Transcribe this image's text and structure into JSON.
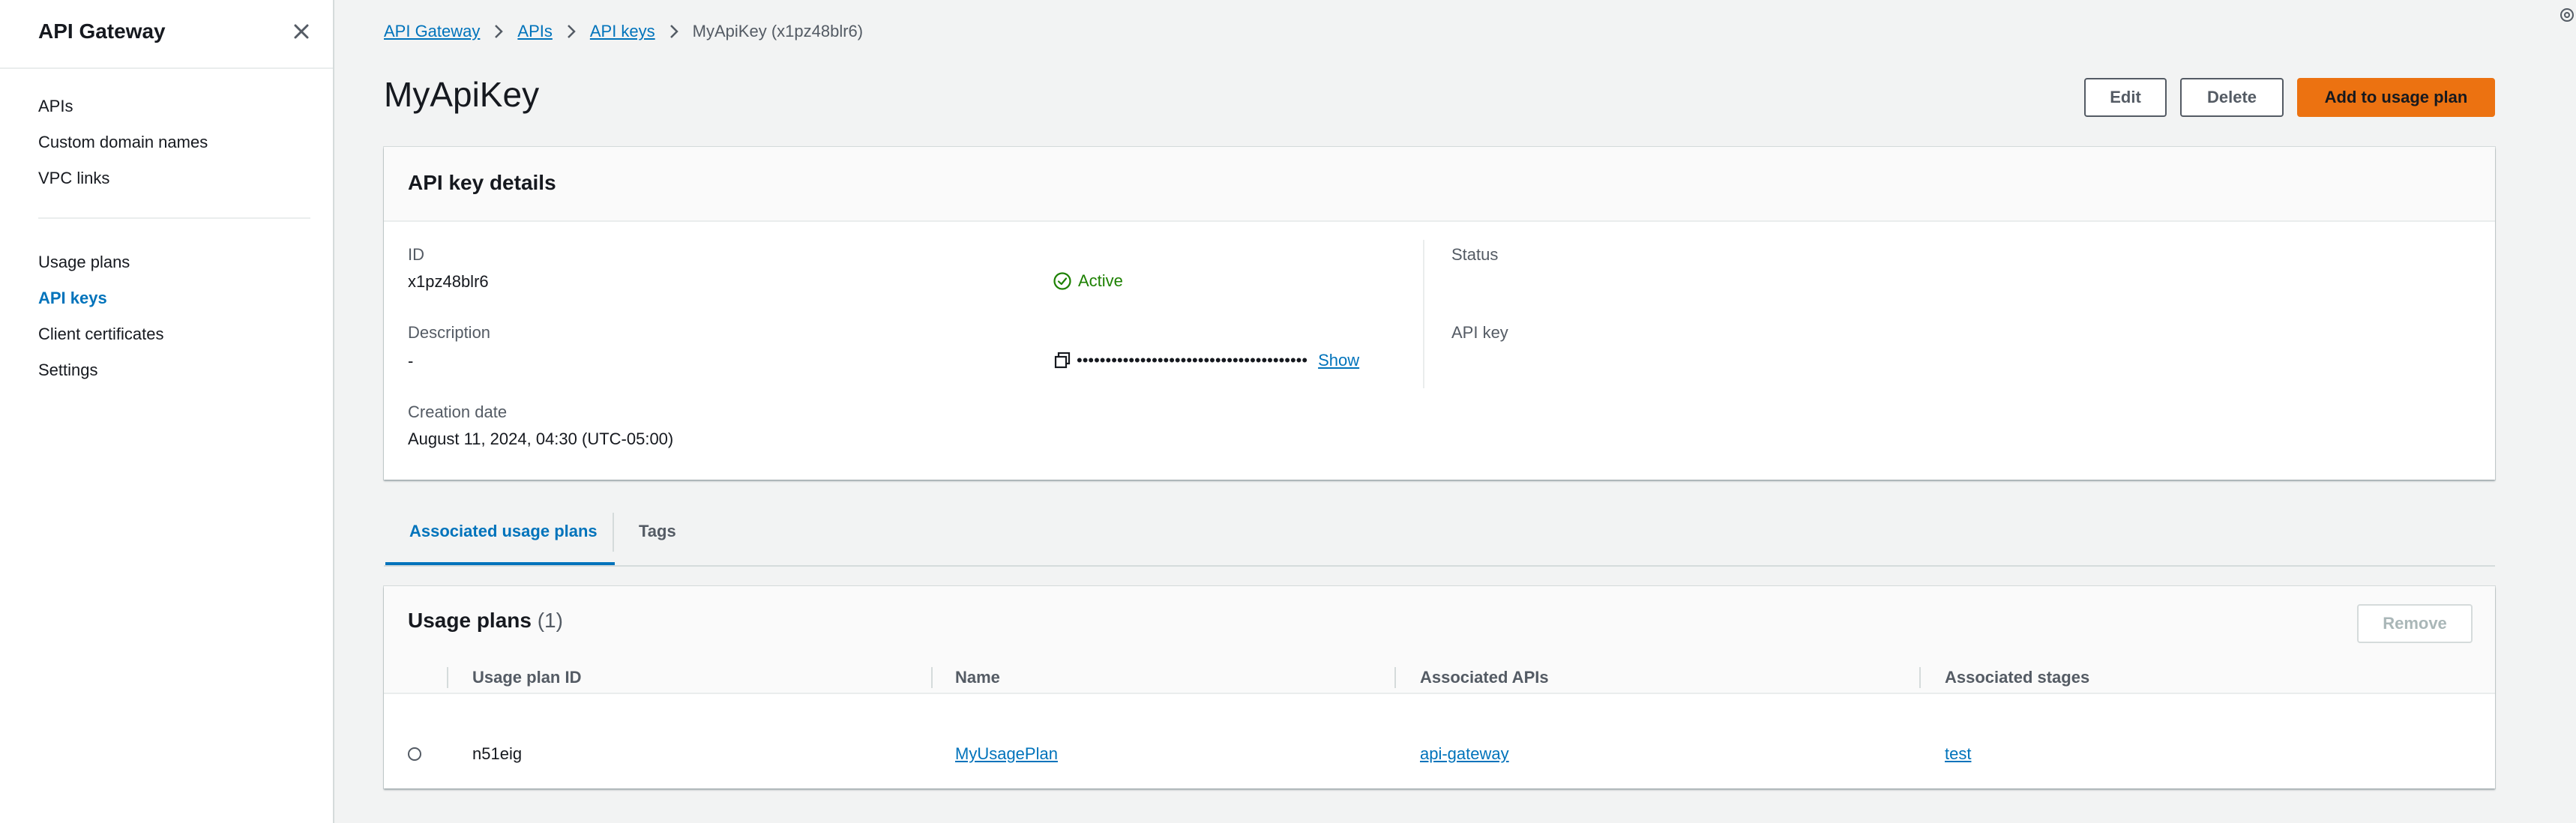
{
  "sidebar": {
    "title": "API Gateway",
    "group1": [
      {
        "label": "APIs"
      },
      {
        "label": "Custom domain names"
      },
      {
        "label": "VPC links"
      }
    ],
    "group2": [
      {
        "label": "Usage plans"
      },
      {
        "label": "API keys",
        "active": true
      },
      {
        "label": "Client certificates"
      },
      {
        "label": "Settings"
      }
    ]
  },
  "breadcrumb": {
    "items": [
      "API Gateway",
      "APIs",
      "API keys"
    ],
    "current": "MyApiKey (x1pz48blr6)"
  },
  "header": {
    "title": "MyApiKey",
    "edit_label": "Edit",
    "delete_label": "Delete",
    "add_label": "Add to usage plan"
  },
  "details": {
    "title": "API key details",
    "id_label": "ID",
    "id_value": "x1pz48blr6",
    "description_label": "Description",
    "description_value": "-",
    "creation_label": "Creation date",
    "creation_value": "August 11, 2024, 04:30 (UTC-05:00)",
    "status_label": "Status",
    "status_value": "Active",
    "apikey_label": "API key",
    "apikey_masked": "••••••••••••••••••••••••••••••••••••••••",
    "show_label": "Show",
    "status_color": "#1d8102"
  },
  "tabs": [
    {
      "label": "Associated usage plans",
      "active": true
    },
    {
      "label": "Tags",
      "active": false
    }
  ],
  "usage_plans": {
    "title": "Usage plans",
    "count": "(1)",
    "remove_label": "Remove",
    "columns": [
      "Usage plan ID",
      "Name",
      "Associated APIs",
      "Associated stages"
    ],
    "rows": [
      {
        "id": "n51eig",
        "name": "MyUsagePlan",
        "apis": "api-gateway",
        "stages": "test"
      }
    ]
  },
  "colors": {
    "accent": "#0073bb",
    "primary_button": "#ec7211",
    "background": "#f2f3f3"
  }
}
